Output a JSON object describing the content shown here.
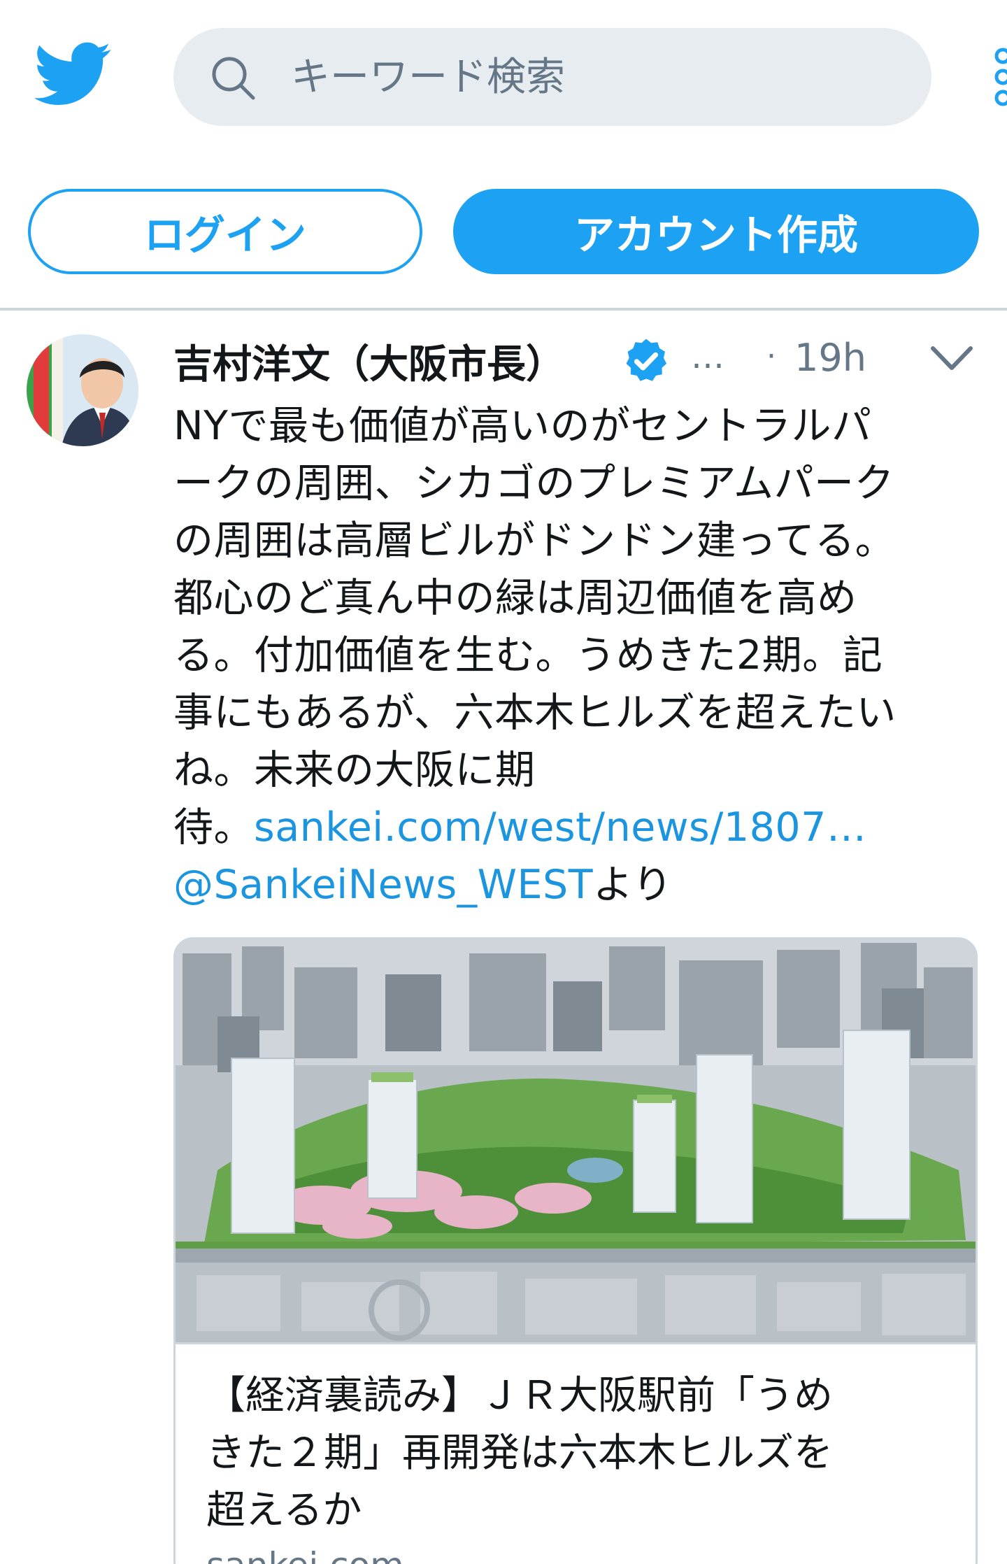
{
  "header": {
    "logo_icon": "twitter-bird-icon",
    "search": {
      "placeholder": "キーワード検索",
      "icon": "search-icon"
    },
    "menu_icon": "more-icon"
  },
  "auth": {
    "login_label": "ログイン",
    "signup_label": "アカウント作成"
  },
  "colors": {
    "brand": "#1da1f2",
    "link": "#1b95e0",
    "muted": "#657786",
    "search_bg": "#e6ecf0"
  },
  "tweet": {
    "author_name": "吉村洋文（大阪市長）",
    "verified_icon": "verified-badge-icon",
    "handle_truncated": "…",
    "time_separator": "·",
    "time": "19h",
    "menu_icon": "chevron-down-icon",
    "text_lines": [
      "NYで最も価値が高いのがセントラルパ",
      "ークの周囲、シカゴのプレミアムパーク",
      "の周囲は高層ビルがドンドン建ってる。",
      "都心のど真ん中の緑は周辺価値を高め",
      "る。付加価値を生む。うめきた2期。記",
      "事にもあるが、六本木ヒルズを超えたい",
      "ね。未来の大阪に期"
    ],
    "text_tail_prefix": "待。",
    "link_text": "sankei.com/west/news/1807…",
    "mention": "@SankeiNews_WEST",
    "mention_suffix": "より",
    "card": {
      "image_alt": "うめきた2期 再開発 完成予想図",
      "title_lines": [
        "【経済裏読み】ＪＲ大阪駅前「うめ",
        "きた２期」再開発は六本木ヒルズを",
        "超えるか"
      ],
      "domain": "sankei.com"
    }
  }
}
